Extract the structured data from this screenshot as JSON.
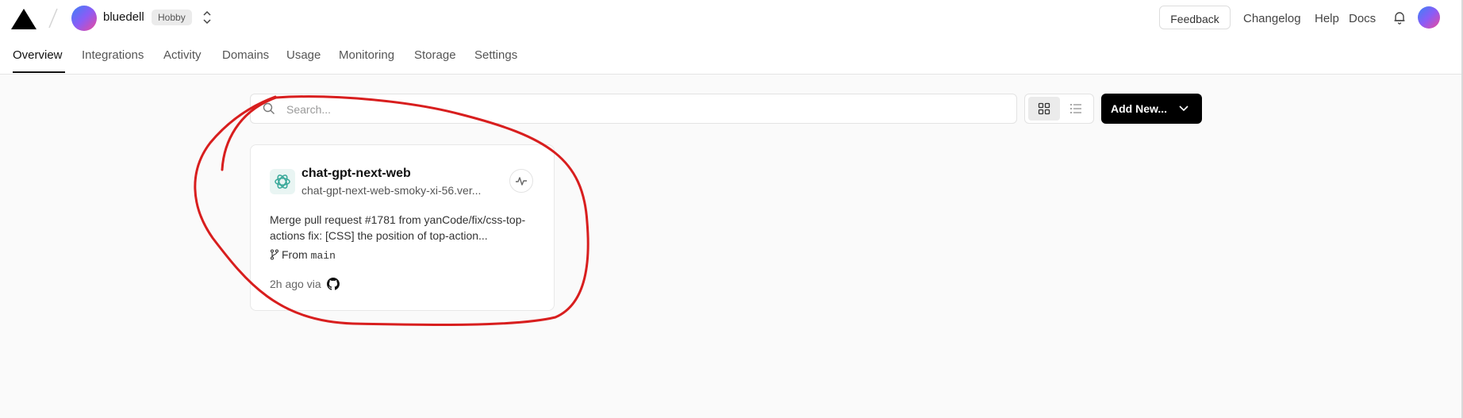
{
  "header": {
    "team_name": "bluedell",
    "plan": "Hobby",
    "feedback_label": "Feedback",
    "links": [
      "Changelog",
      "Help",
      "Docs"
    ]
  },
  "tabs": [
    "Overview",
    "Integrations",
    "Activity",
    "Domains",
    "Usage",
    "Monitoring",
    "Storage",
    "Settings"
  ],
  "active_tab": "Overview",
  "toolbar": {
    "search_placeholder": "Search...",
    "view_mode": "grid",
    "add_new_label": "Add New..."
  },
  "project": {
    "name": "chat-gpt-next-web",
    "domain": "chat-gpt-next-web-smoky-xi-56.ver...",
    "commit_message": "Merge pull request #1781 from yanCode/fix/css-top-actions fix: [CSS] the position of top-action...",
    "branch_prefix": "From",
    "branch": "main",
    "time_ago": "2h ago via",
    "icon": "openai-icon",
    "via_icon": "github-icon"
  },
  "annotation": {
    "color": "#d81e1e",
    "shape": "hand-drawn circle around project card"
  }
}
